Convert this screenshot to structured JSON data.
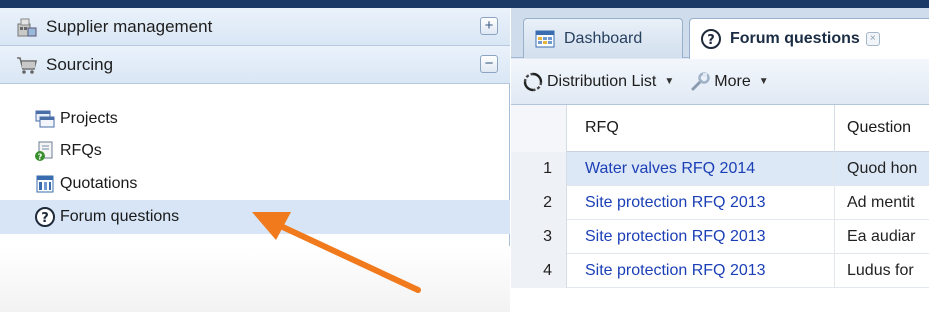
{
  "sidebar": {
    "headers": [
      {
        "label": "Supplier management",
        "toggle": "+",
        "icon": "supplier-management-icon"
      },
      {
        "label": "Sourcing",
        "toggle": "−",
        "icon": "cart-icon"
      }
    ],
    "items": [
      {
        "label": "Projects",
        "icon": "projects-icon",
        "selected": false
      },
      {
        "label": "RFQs",
        "icon": "rfqs-icon",
        "selected": false
      },
      {
        "label": "Quotations",
        "icon": "quotations-icon",
        "selected": false
      },
      {
        "label": "Forum questions",
        "icon": "question-icon",
        "selected": true
      }
    ]
  },
  "tabs": [
    {
      "label": "Dashboard",
      "icon": "dashboard-icon",
      "active": false
    },
    {
      "label": "Forum questions",
      "icon": "question-icon",
      "active": true,
      "close": "×"
    }
  ],
  "toolbar": {
    "distribution_label": "Distribution List",
    "more_label": "More",
    "caret": "▼"
  },
  "grid": {
    "columns": [
      "RFQ",
      "Question"
    ],
    "rows": [
      {
        "num": "1",
        "rfq": "Water valves RFQ 2014",
        "question": "Quod hon",
        "selected": true
      },
      {
        "num": "2",
        "rfq": "Site protection RFQ 2013",
        "question": "Ad mentit",
        "selected": false
      },
      {
        "num": "3",
        "rfq": "Site protection RFQ 2013",
        "question": "Ea audiar",
        "selected": false
      },
      {
        "num": "4",
        "rfq": "Site protection RFQ 2013",
        "question": "Ludus for",
        "selected": false
      }
    ]
  },
  "colors": {
    "accent_arrow": "#f07a1c",
    "link": "#1b3fb6",
    "header_bar": "#1c3a66"
  }
}
